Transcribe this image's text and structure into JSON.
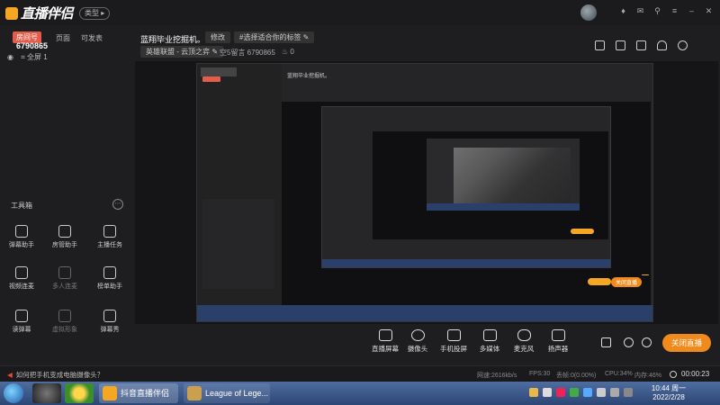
{
  "app": {
    "logo_text": "直播伴侣",
    "type_button": "类型",
    "window_icons": [
      "shirt-icon",
      "mail-icon",
      "pin-icon",
      "menu-icon",
      "minimize-icon",
      "close-icon"
    ]
  },
  "sidebar": {
    "room_tag": "房间号",
    "room_id": "6790865",
    "tabs": [
      "页面",
      "可发表"
    ],
    "scene_label": "全屏 1",
    "tools_title": "工具箱",
    "tools": [
      {
        "label": "弹幕助手",
        "icon": "chat-icon",
        "enabled": true
      },
      {
        "label": "房管助手",
        "icon": "user-icon",
        "enabled": true
      },
      {
        "label": "主播任务",
        "icon": "task-check-icon",
        "enabled": true
      },
      {
        "label": "视频连麦",
        "icon": "video-call-icon",
        "enabled": true
      },
      {
        "label": "多人连麦",
        "icon": "group-call-icon",
        "enabled": false
      },
      {
        "label": "榜单助手",
        "icon": "trophy-icon",
        "enabled": true
      },
      {
        "label": "读弹幕",
        "icon": "read-danmaku-icon",
        "enabled": true
      },
      {
        "label": "虚拟形象",
        "icon": "avatar-icon",
        "enabled": false
      },
      {
        "label": "弹幕秀",
        "icon": "tv-icon",
        "enabled": true
      }
    ]
  },
  "header": {
    "stream_title": "蓝翔毕业挖掘机。",
    "edit_label": "修改",
    "tag_label": "#选择适合你的标签",
    "category_label": "英雄联盟 - 云顶之弈",
    "room_info": "空5留言  6790865",
    "fans": "0"
  },
  "controls": {
    "buttons": [
      {
        "label": "直播屏幕",
        "icon": "screen-icon"
      },
      {
        "label": "摄像头",
        "icon": "camera-icon"
      },
      {
        "label": "手机投屏",
        "icon": "phone-cast-icon"
      },
      {
        "label": "多媒体",
        "icon": "play-icon"
      },
      {
        "label": "麦克风",
        "icon": "microphone-icon"
      },
      {
        "label": "扬声器",
        "icon": "speaker-icon"
      }
    ],
    "go_live_label": "关闭直播"
  },
  "status": {
    "tip": "如何把手机变成电脑摄像头？",
    "network": "网速:2616kb/s",
    "fps": "FPS:30",
    "dropped": "丢帧:0(0.00%)",
    "cpu": "CPU:34%",
    "memory": "内存:46%",
    "live_time": "00:00:23"
  },
  "taskbar": {
    "apps": [
      {
        "label": "抖音直播伴侣",
        "color": "#f5a623"
      },
      {
        "label": "League of Lege...",
        "color": "#c8a050"
      }
    ],
    "time": "10:44 周一",
    "date": "2022/2/28"
  },
  "preview": {
    "nested_title": "蓝翔毕业挖掘机。",
    "nested_go_live": "关闭直播"
  }
}
